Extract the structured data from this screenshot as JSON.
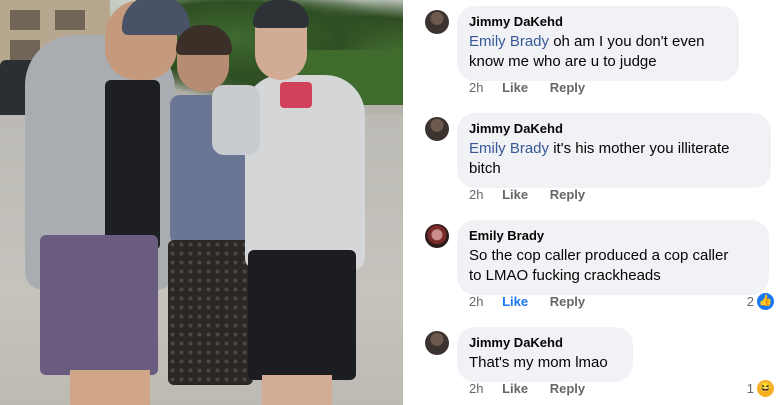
{
  "photo": {
    "alt_name": "family-photo"
  },
  "comments": [
    {
      "author": "Jimmy DaKehd",
      "mention": "Emily Brady",
      "text_lines": [
        "oh am I you don't even",
        "know me who are u to judge"
      ],
      "time": "2h",
      "like": "Like",
      "reply": "Reply",
      "like_active": false,
      "reaction_count": "",
      "reaction_icon": ""
    },
    {
      "author": "Jimmy DaKehd",
      "mention": "Emily Brady",
      "text_lines": [
        "it's his mother you illiterate",
        "bitch"
      ],
      "time": "2h",
      "like": "Like",
      "reply": "Reply",
      "like_active": false,
      "reaction_count": "",
      "reaction_icon": ""
    },
    {
      "author": "Emily Brady",
      "mention": "",
      "text_lines": [
        "So the cop caller produced a cop caller",
        "to LMAO fucking crackheads"
      ],
      "time": "2h",
      "like": "Like",
      "reply": "Reply",
      "like_active": true,
      "reaction_count": "2",
      "reaction_icon": "like-reaction-icon"
    },
    {
      "author": "Jimmy DaKehd",
      "mention": "",
      "text_lines": [
        "That's my mom lmao"
      ],
      "time": "2h",
      "like": "Like",
      "reply": "Reply",
      "like_active": false,
      "reaction_count": "1",
      "reaction_icon": "haha-reaction-icon"
    }
  ],
  "colors": {
    "bubble": "#f0f2f5",
    "mention": "#385898",
    "like_active": "#1877f2",
    "meta": "#65676b"
  }
}
